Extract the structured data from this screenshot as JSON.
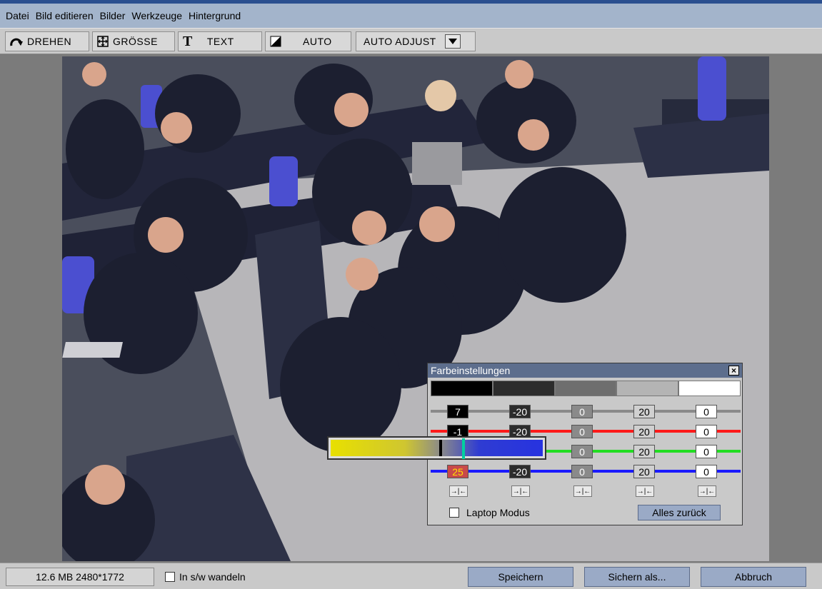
{
  "menu": [
    "Datei",
    "Bild editieren",
    "Bilder",
    "Werkzeuge",
    "Hintergrund"
  ],
  "toolbar": {
    "rotate": "DREHEN",
    "size": "GRÖSSE",
    "text": "TEXT",
    "auto": "AUTO",
    "auto_adjust": "AUTO ADJUST"
  },
  "photo": {
    "alt": "Photo of seated people in a parliament chamber"
  },
  "status": {
    "info": "12.6 MB  2480*1772",
    "sw_label": "In s/w wandeln",
    "save": "Speichern",
    "save_as": "Sichern als...",
    "cancel": "Abbruch"
  },
  "dialog": {
    "title": "Farbeinstellungen",
    "close": "×",
    "swatch_colors": [
      "#000000",
      "#2c2c2c",
      "#6e6e6e",
      "#b4b4b4",
      "#ffffff"
    ],
    "rows": [
      {
        "name": "brightness",
        "line": "#8a8a8a",
        "values": [
          "7",
          "-20",
          "0",
          "20",
          "0"
        ]
      },
      {
        "name": "red",
        "line": "#ff1a1a",
        "values": [
          "-1",
          "-20",
          "0",
          "20",
          "0"
        ]
      },
      {
        "name": "green",
        "line": "#22dd22",
        "values": [
          "",
          "",
          "0",
          "20",
          "0"
        ]
      },
      {
        "name": "blue",
        "line": "#1a1aff",
        "values": [
          "25",
          "-20",
          "0",
          "20",
          "0"
        ]
      }
    ],
    "arrow_label": "→|←",
    "laptop_label": "Laptop Modus",
    "reset": "Alles zurück"
  },
  "slider": {
    "level": 0.64
  }
}
